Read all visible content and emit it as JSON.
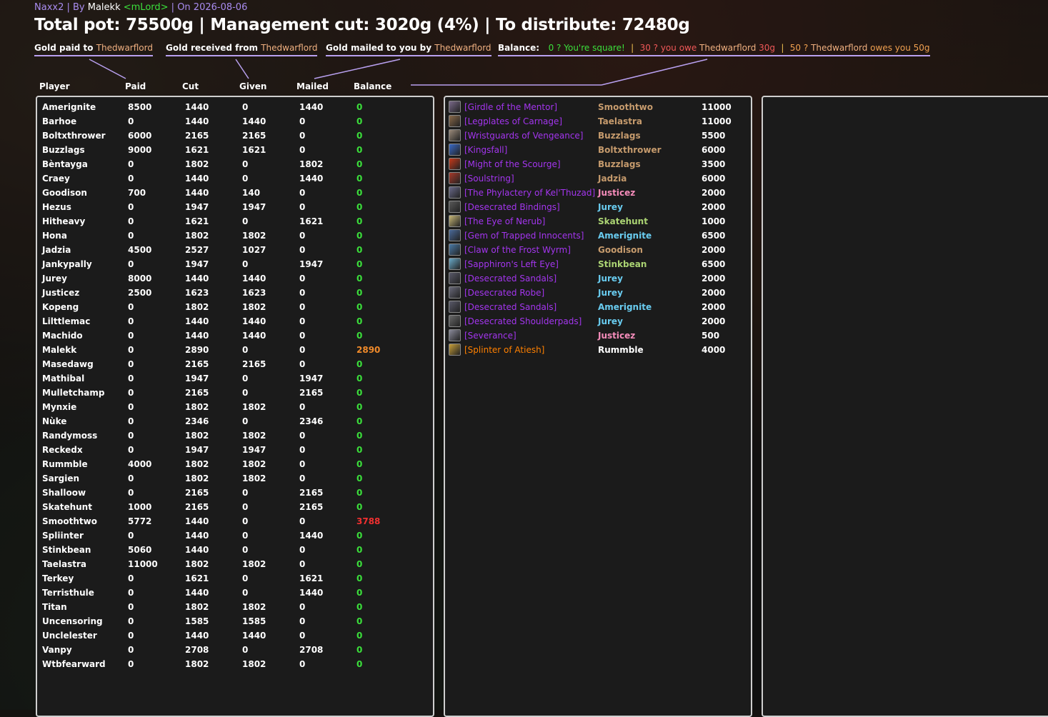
{
  "header": {
    "raid": "Naxx2",
    "by_prefix": " | By ",
    "author": "Malekk",
    "guild": "<mLord>",
    "date_prefix": " | On ",
    "date": "2026-08-06",
    "pot_line": "Total pot: 75500g | Management cut: 3020g (4%) | To distribute: 72480g"
  },
  "legend": {
    "paid_label": "Gold paid to ",
    "received_label": "Gold received from ",
    "mailed_label": "Gold mailed to you by ",
    "name": "Thedwarflord",
    "balance_label": "Balance:",
    "square_text": "0 ? You're square!",
    "sep": "|",
    "owe_prefix": "30 ? you owe ",
    "owe_suffix": " 30g",
    "owes_prefix": "50 ? ",
    "owes_suffix": " owes you 50g"
  },
  "columns": {
    "player": "Player",
    "paid": "Paid",
    "cut": "Cut",
    "given": "Given",
    "mailed": "Mailed",
    "balance": "Balance"
  },
  "colors": {
    "positive": "#3be03b",
    "owed": "#f08a2a",
    "owes": "#f03030",
    "epic": "#a335ee",
    "legendary": "#ff8000",
    "panel_border": "#cfcfcf"
  },
  "players": [
    {
      "name": "Amerignite",
      "paid": "8500",
      "cut": "1440",
      "given": "0",
      "mailed": "1440",
      "balance": "0",
      "status": "even"
    },
    {
      "name": "Barhoe",
      "paid": "0",
      "cut": "1440",
      "given": "1440",
      "mailed": "0",
      "balance": "0",
      "status": "even"
    },
    {
      "name": "Boltxthrower",
      "paid": "6000",
      "cut": "2165",
      "given": "2165",
      "mailed": "0",
      "balance": "0",
      "status": "even"
    },
    {
      "name": "Buzzlags",
      "paid": "9000",
      "cut": "1621",
      "given": "1621",
      "mailed": "0",
      "balance": "0",
      "status": "even"
    },
    {
      "name": "Bèntayga",
      "paid": "0",
      "cut": "1802",
      "given": "0",
      "mailed": "1802",
      "balance": "0",
      "status": "even"
    },
    {
      "name": "Craey",
      "paid": "0",
      "cut": "1440",
      "given": "0",
      "mailed": "1440",
      "balance": "0",
      "status": "even"
    },
    {
      "name": "Goodison",
      "paid": "700",
      "cut": "1440",
      "given": "140",
      "mailed": "0",
      "balance": "0",
      "status": "even"
    },
    {
      "name": "Hezus",
      "paid": "0",
      "cut": "1947",
      "given": "1947",
      "mailed": "0",
      "balance": "0",
      "status": "even"
    },
    {
      "name": "Hitheavy",
      "paid": "0",
      "cut": "1621",
      "given": "0",
      "mailed": "1621",
      "balance": "0",
      "status": "even"
    },
    {
      "name": "Hona",
      "paid": "0",
      "cut": "1802",
      "given": "1802",
      "mailed": "0",
      "balance": "0",
      "status": "even"
    },
    {
      "name": "Jadzia",
      "paid": "4500",
      "cut": "2527",
      "given": "1027",
      "mailed": "0",
      "balance": "0",
      "status": "even"
    },
    {
      "name": "Jankypally",
      "paid": "0",
      "cut": "1947",
      "given": "0",
      "mailed": "1947",
      "balance": "0",
      "status": "even"
    },
    {
      "name": "Jurey",
      "paid": "8000",
      "cut": "1440",
      "given": "1440",
      "mailed": "0",
      "balance": "0",
      "status": "even"
    },
    {
      "name": "Justicez",
      "paid": "2500",
      "cut": "1623",
      "given": "1623",
      "mailed": "0",
      "balance": "0",
      "status": "even"
    },
    {
      "name": "Kopeng",
      "paid": "0",
      "cut": "1802",
      "given": "1802",
      "mailed": "0",
      "balance": "0",
      "status": "even"
    },
    {
      "name": "Lilttlemac",
      "paid": "0",
      "cut": "1440",
      "given": "1440",
      "mailed": "0",
      "balance": "0",
      "status": "even"
    },
    {
      "name": "Machido",
      "paid": "0",
      "cut": "1440",
      "given": "1440",
      "mailed": "0",
      "balance": "0",
      "status": "even"
    },
    {
      "name": "Malekk",
      "paid": "0",
      "cut": "2890",
      "given": "0",
      "mailed": "0",
      "balance": "2890",
      "status": "owed"
    },
    {
      "name": "Masedawg",
      "paid": "0",
      "cut": "2165",
      "given": "2165",
      "mailed": "0",
      "balance": "0",
      "status": "even"
    },
    {
      "name": "Mathibal",
      "paid": "0",
      "cut": "1947",
      "given": "0",
      "mailed": "1947",
      "balance": "0",
      "status": "even"
    },
    {
      "name": "Mulletchamp",
      "paid": "0",
      "cut": "2165",
      "given": "0",
      "mailed": "2165",
      "balance": "0",
      "status": "even"
    },
    {
      "name": "Mynxie",
      "paid": "0",
      "cut": "1802",
      "given": "1802",
      "mailed": "0",
      "balance": "0",
      "status": "even"
    },
    {
      "name": "Nùke",
      "paid": "0",
      "cut": "2346",
      "given": "0",
      "mailed": "2346",
      "balance": "0",
      "status": "even"
    },
    {
      "name": "Randymoss",
      "paid": "0",
      "cut": "1802",
      "given": "1802",
      "mailed": "0",
      "balance": "0",
      "status": "even"
    },
    {
      "name": "Reckedx",
      "paid": "0",
      "cut": "1947",
      "given": "1947",
      "mailed": "0",
      "balance": "0",
      "status": "even"
    },
    {
      "name": "Rummble",
      "paid": "4000",
      "cut": "1802",
      "given": "1802",
      "mailed": "0",
      "balance": "0",
      "status": "even"
    },
    {
      "name": "Sargien",
      "paid": "0",
      "cut": "1802",
      "given": "1802",
      "mailed": "0",
      "balance": "0",
      "status": "even"
    },
    {
      "name": "Shalloow",
      "paid": "0",
      "cut": "2165",
      "given": "0",
      "mailed": "2165",
      "balance": "0",
      "status": "even"
    },
    {
      "name": "Skatehunt",
      "paid": "1000",
      "cut": "2165",
      "given": "0",
      "mailed": "2165",
      "balance": "0",
      "status": "even"
    },
    {
      "name": "Smoothtwo",
      "paid": "5772",
      "cut": "1440",
      "given": "0",
      "mailed": "0",
      "balance": "3788",
      "status": "owes"
    },
    {
      "name": "Spliinter",
      "paid": "0",
      "cut": "1440",
      "given": "0",
      "mailed": "1440",
      "balance": "0",
      "status": "even"
    },
    {
      "name": "Stinkbean",
      "paid": "5060",
      "cut": "1440",
      "given": "0",
      "mailed": "0",
      "balance": "0",
      "status": "even"
    },
    {
      "name": "Taelastra",
      "paid": "11000",
      "cut": "1802",
      "given": "1802",
      "mailed": "0",
      "balance": "0",
      "status": "even"
    },
    {
      "name": "Terkey",
      "paid": "0",
      "cut": "1621",
      "given": "0",
      "mailed": "1621",
      "balance": "0",
      "status": "even"
    },
    {
      "name": "Terristhule",
      "paid": "0",
      "cut": "1440",
      "given": "0",
      "mailed": "1440",
      "balance": "0",
      "status": "even"
    },
    {
      "name": "Titan",
      "paid": "0",
      "cut": "1802",
      "given": "1802",
      "mailed": "0",
      "balance": "0",
      "status": "even"
    },
    {
      "name": "Uncensoring",
      "paid": "0",
      "cut": "1585",
      "given": "1585",
      "mailed": "0",
      "balance": "0",
      "status": "even"
    },
    {
      "name": "Unclelester",
      "paid": "0",
      "cut": "1440",
      "given": "1440",
      "mailed": "0",
      "balance": "0",
      "status": "even"
    },
    {
      "name": "Vanpy",
      "paid": "0",
      "cut": "2708",
      "given": "0",
      "mailed": "2708",
      "balance": "0",
      "status": "even"
    },
    {
      "name": "Wtbfearward",
      "paid": "0",
      "cut": "1802",
      "given": "1802",
      "mailed": "0",
      "balance": "0",
      "status": "even"
    }
  ],
  "loot": [
    {
      "item": "[Girdle of the Mentor]",
      "winner": "Smoothtwo",
      "amount": "11000",
      "quality": "epic",
      "winner_color": "#c69b6d",
      "icon": "girdle-icon",
      "icon_color": "#7a6a8a"
    },
    {
      "item": "[Legplates of Carnage]",
      "winner": "Taelastra",
      "amount": "11000",
      "quality": "epic",
      "winner_color": "#c69b6d",
      "icon": "legplates-icon",
      "icon_color": "#8a6a4a"
    },
    {
      "item": "[Wristguards of Vengeance]",
      "winner": "Buzzlags",
      "amount": "5500",
      "quality": "epic",
      "winner_color": "#c69b6d",
      "icon": "wristguards-icon",
      "icon_color": "#9a8a7a"
    },
    {
      "item": "[Kingsfall]",
      "winner": "Boltxthrower",
      "amount": "6000",
      "quality": "epic",
      "winner_color": "#c69b6d",
      "icon": "dagger-icon",
      "icon_color": "#3a6ac8"
    },
    {
      "item": "[Might of the Scourge]",
      "winner": "Buzzlags",
      "amount": "3500",
      "quality": "epic",
      "winner_color": "#c69b6d",
      "icon": "shoulder-icon",
      "icon_color": "#c83a1a"
    },
    {
      "item": "[Soulstring]",
      "winner": "Jadzia",
      "amount": "6000",
      "quality": "epic",
      "winner_color": "#c69b6d",
      "icon": "bow-icon",
      "icon_color": "#a83a2a"
    },
    {
      "item": "[The Phylactery of Kel'Thuzad]",
      "winner": "Justicez",
      "amount": "2000",
      "quality": "epic",
      "winner_color": "#f58cba",
      "icon": "phylactery-icon",
      "icon_color": "#6a6a8a"
    },
    {
      "item": "[Desecrated Bindings]",
      "winner": "Jurey",
      "amount": "2000",
      "quality": "epic",
      "winner_color": "#69ccf0",
      "icon": "bindings-icon",
      "icon_color": "#5a5a5a"
    },
    {
      "item": "[The Eye of Nerub]",
      "winner": "Skatehunt",
      "amount": "1000",
      "quality": "epic",
      "winner_color": "#abd473",
      "icon": "polearm-icon",
      "icon_color": "#c8b878"
    },
    {
      "item": "[Gem of Trapped Innocents]",
      "winner": "Amerignite",
      "amount": "6500",
      "quality": "epic",
      "winner_color": "#69ccf0",
      "icon": "gem-icon",
      "icon_color": "#4a6a9a"
    },
    {
      "item": "[Claw of the Frost Wyrm]",
      "winner": "Goodison",
      "amount": "2000",
      "quality": "epic",
      "winner_color": "#c69b6d",
      "icon": "claw-icon",
      "icon_color": "#4a7aa8"
    },
    {
      "item": "[Sapphiron's Left Eye]",
      "winner": "Stinkbean",
      "amount": "6500",
      "quality": "epic",
      "winner_color": "#abd473",
      "icon": "eye-icon",
      "icon_color": "#6aaac8"
    },
    {
      "item": "[Desecrated Sandals]",
      "winner": "Jurey",
      "amount": "2000",
      "quality": "epic",
      "winner_color": "#69ccf0",
      "icon": "sandals-icon",
      "icon_color": "#5a5a6a"
    },
    {
      "item": "[Desecrated Robe]",
      "winner": "Jurey",
      "amount": "2000",
      "quality": "epic",
      "winner_color": "#69ccf0",
      "icon": "robe-icon",
      "icon_color": "#6a6a7a"
    },
    {
      "item": "[Desecrated Sandals]",
      "winner": "Amerignite",
      "amount": "2000",
      "quality": "epic",
      "winner_color": "#69ccf0",
      "icon": "sandals-icon",
      "icon_color": "#5a5a6a"
    },
    {
      "item": "[Desecrated Shoulderpads]",
      "winner": "Jurey",
      "amount": "2000",
      "quality": "epic",
      "winner_color": "#69ccf0",
      "icon": "shoulderpads-icon",
      "icon_color": "#6a6a6a"
    },
    {
      "item": "[Severance]",
      "winner": "Justicez",
      "amount": "500",
      "quality": "epic",
      "winner_color": "#f58cba",
      "icon": "axe-icon",
      "icon_color": "#8a8a9a"
    },
    {
      "item": "[Splinter of Atiesh]",
      "winner": "Rummble",
      "amount": "4000",
      "quality": "legendary",
      "winner_color": "#ffffff",
      "icon": "splinter-icon",
      "icon_color": "#c8a03a"
    }
  ]
}
